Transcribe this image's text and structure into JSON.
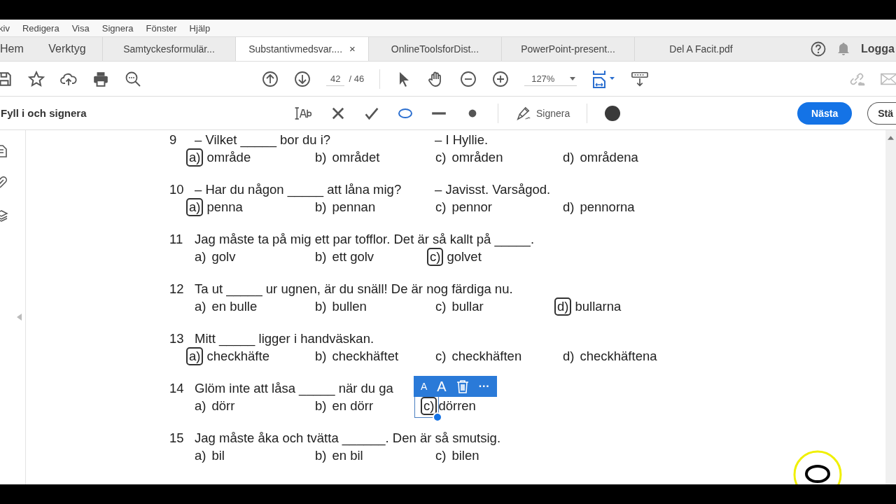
{
  "menu_bar": [
    "kiv",
    "Redigera",
    "Visa",
    "Signera",
    "Fönster",
    "Hjälp"
  ],
  "tabs": [
    {
      "label": "Hem",
      "kind": "nav",
      "selected": false
    },
    {
      "label": "Verktyg",
      "kind": "nav",
      "selected": false
    },
    {
      "label": "Samtyckesformulär...",
      "kind": "doc",
      "selected": false
    },
    {
      "label": "Substantivmedsvar....",
      "kind": "doc",
      "selected": true,
      "close": "×"
    },
    {
      "label": "OnlineToolsforDist...",
      "kind": "doc",
      "selected": false
    },
    {
      "label": "PowerPoint-present...",
      "kind": "doc",
      "selected": false
    },
    {
      "label": "Del A Facit.pdf",
      "kind": "doc",
      "selected": false
    }
  ],
  "account": {
    "login": "Logga"
  },
  "toolbar": {
    "page": "42",
    "page_total": "/ 46",
    "zoom": "127%"
  },
  "fill_sign": {
    "title": "Fyll i och signera",
    "sign": "Signera",
    "next": "Nästa",
    "start": "Stä"
  },
  "questions": [
    {
      "number": "9",
      "prompt": "– Vilket _____ bor du i?",
      "reply": "– I Hyllie.",
      "options": [
        {
          "letter": "a)",
          "text": "område",
          "selected": true
        },
        {
          "letter": "b)",
          "text": "området",
          "selected": false
        },
        {
          "letter": "c)",
          "text": "områden",
          "selected": false
        },
        {
          "letter": "d)",
          "text": "områdena",
          "selected": false
        }
      ]
    },
    {
      "number": "10",
      "prompt": "– Har du någon _____ att låna mig?",
      "reply": "– Javisst. Varsågod.",
      "options": [
        {
          "letter": "a)",
          "text": "penna",
          "selected": true
        },
        {
          "letter": "b)",
          "text": "pennan",
          "selected": false
        },
        {
          "letter": "c)",
          "text": "pennor",
          "selected": false
        },
        {
          "letter": "d)",
          "text": "pennorna",
          "selected": false
        }
      ]
    },
    {
      "number": "11",
      "prompt": "Jag måste ta på mig ett par tofflor. Det är så kallt på _____.",
      "options": [
        {
          "letter": "a)",
          "text": "golv",
          "selected": false
        },
        {
          "letter": "b)",
          "text": "ett golv",
          "selected": false
        },
        {
          "letter": "c)",
          "text": "golvet",
          "selected": true
        }
      ]
    },
    {
      "number": "12",
      "prompt": "Ta ut _____ ur ugnen, är du snäll! De är nog färdiga nu.",
      "options": [
        {
          "letter": "a)",
          "text": "en bulle",
          "selected": false
        },
        {
          "letter": "b)",
          "text": "bullen",
          "selected": false
        },
        {
          "letter": "c)",
          "text": "bullar",
          "selected": false
        },
        {
          "letter": "d)",
          "text": "bullarna",
          "selected": true
        }
      ]
    },
    {
      "number": "13",
      "prompt": "Mitt _____ ligger i handväskan.",
      "options": [
        {
          "letter": "a)",
          "text": "checkhäfte",
          "selected": true
        },
        {
          "letter": "b)",
          "text": "checkhäftet",
          "selected": false
        },
        {
          "letter": "c)",
          "text": "checkhäften",
          "selected": false
        },
        {
          "letter": "d)",
          "text": "checkhäftena",
          "selected": false
        }
      ]
    },
    {
      "number": "14",
      "prompt": "Glöm inte att låsa _____ när du ga",
      "options": [
        {
          "letter": "a)",
          "text": "dörr",
          "selected": false
        },
        {
          "letter": "b)",
          "text": "en dörr",
          "selected": false
        },
        {
          "letter": "c)",
          "text": "dörren",
          "selected": true,
          "editing": true
        }
      ]
    },
    {
      "number": "15",
      "prompt": "Jag måste åka och tvätta ______. Den är så smutsig.",
      "options": [
        {
          "letter": "a)",
          "text": "bil",
          "selected": false
        },
        {
          "letter": "b)",
          "text": "en bil",
          "selected": false
        },
        {
          "letter": "c)",
          "text": "bilen",
          "selected": false
        }
      ]
    }
  ],
  "edit_toolbar": {
    "small": "A",
    "large": "A",
    "more": "···"
  }
}
